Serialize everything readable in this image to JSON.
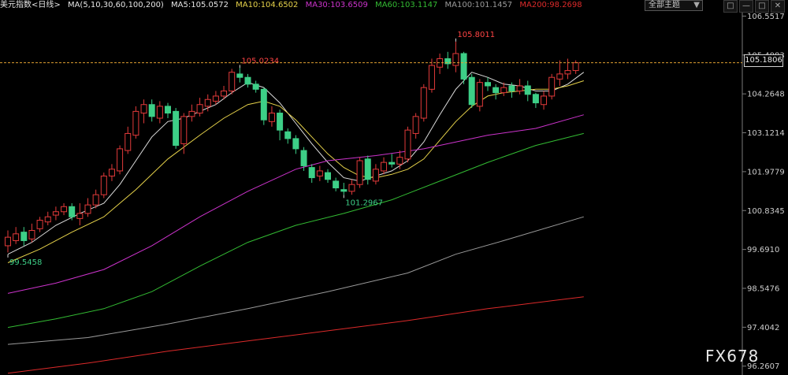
{
  "header": {
    "symbol": "美元指数",
    "period": "<日线>",
    "ma_params": "MA(5,10,30,60,100,200)",
    "ma5": "MA5:105.0572",
    "ma10": "MA10:104.6502",
    "ma30": "MA30:103.6509",
    "ma60": "MA60:103.1147",
    "ma100": "MA100:101.1457",
    "ma200": "MA200:98.2698"
  },
  "selector": {
    "label": "全部主题",
    "arrow": "▼"
  },
  "window_buttons": [
    "□",
    "—",
    "□",
    "✕"
  ],
  "watermark": "FX678",
  "current_price_tag": "105.1806",
  "colors": {
    "background": "#000000",
    "up_candle": "#e23a3a",
    "down_candle": "#3dcf87",
    "ma5": "#dcdcdc",
    "ma10": "#e6d24a",
    "ma30": "#cc33cc",
    "ma60": "#33bb33",
    "ma100": "#9a9a9a",
    "ma200": "#dd2a2a",
    "axis_text": "#cccccc",
    "annotation_high": "#ff4444",
    "annotation_low": "#3dcf87",
    "price_line": "#e0a030"
  },
  "chart_data": {
    "type": "candlestick",
    "y_axis_labels": [
      "106.5517",
      "105.4083",
      "104.2648",
      "103.1214",
      "101.9779",
      "100.8345",
      "99.6910",
      "98.5476",
      "97.4042",
      "96.2607"
    ],
    "ylim": [
      96.0,
      106.7
    ],
    "current_price": 105.1806,
    "annotations": [
      {
        "text": "105.8011",
        "index": 56,
        "value": 105.8011,
        "kind": "high"
      },
      {
        "text": "105.0234",
        "index": 29,
        "value": 105.0234,
        "kind": "high"
      },
      {
        "text": "101.2967",
        "index": 42,
        "value": 101.2967,
        "kind": "low"
      },
      {
        "text": "99.5458",
        "index": 0,
        "value": 99.5458,
        "kind": "low"
      }
    ],
    "candles": [
      [
        99.8,
        100.05,
        100.25,
        99.6
      ],
      [
        99.95,
        100.15,
        100.35,
        99.85
      ],
      [
        100.2,
        99.95,
        100.35,
        99.8
      ],
      [
        100.0,
        100.25,
        100.45,
        99.9
      ],
      [
        100.3,
        100.55,
        100.65,
        100.2
      ],
      [
        100.5,
        100.65,
        100.8,
        100.4
      ],
      [
        100.7,
        100.8,
        100.95,
        100.55
      ],
      [
        100.8,
        100.95,
        101.05,
        100.7
      ],
      [
        100.95,
        100.65,
        101.05,
        100.55
      ],
      [
        100.6,
        100.75,
        101.05,
        100.4
      ],
      [
        100.75,
        101.0,
        101.2,
        100.65
      ],
      [
        101.0,
        101.3,
        101.45,
        100.9
      ],
      [
        101.3,
        101.85,
        101.95,
        101.2
      ],
      [
        101.85,
        102.05,
        102.2,
        101.7
      ],
      [
        102.0,
        102.65,
        102.75,
        101.9
      ],
      [
        102.6,
        103.1,
        103.3,
        102.5
      ],
      [
        103.05,
        103.75,
        103.9,
        102.95
      ],
      [
        103.7,
        103.95,
        104.1,
        103.4
      ],
      [
        103.95,
        103.6,
        104.1,
        103.45
      ],
      [
        103.55,
        103.9,
        104.05,
        103.4
      ],
      [
        103.9,
        103.7,
        104.0,
        103.55
      ],
      [
        103.75,
        102.75,
        103.85,
        102.65
      ],
      [
        102.8,
        103.6,
        103.7,
        102.5
      ],
      [
        103.6,
        103.75,
        103.95,
        103.45
      ],
      [
        103.7,
        103.95,
        104.15,
        103.6
      ],
      [
        103.9,
        104.1,
        104.25,
        103.75
      ],
      [
        104.05,
        104.2,
        104.35,
        103.95
      ],
      [
        104.2,
        104.35,
        104.5,
        104.1
      ],
      [
        104.35,
        104.9,
        105.0,
        104.25
      ],
      [
        104.85,
        104.75,
        105.02,
        104.6
      ],
      [
        104.75,
        104.55,
        104.85,
        104.45
      ],
      [
        104.55,
        104.4,
        104.65,
        104.3
      ],
      [
        104.4,
        103.5,
        104.45,
        103.35
      ],
      [
        103.45,
        103.7,
        103.9,
        103.3
      ],
      [
        103.7,
        103.2,
        103.8,
        102.9
      ],
      [
        103.15,
        102.95,
        103.25,
        102.8
      ],
      [
        102.95,
        102.65,
        103.05,
        102.5
      ],
      [
        102.6,
        102.15,
        102.7,
        102.0
      ],
      [
        102.1,
        101.8,
        102.2,
        101.65
      ],
      [
        101.85,
        102.0,
        102.15,
        101.7
      ],
      [
        101.95,
        101.75,
        102.05,
        101.65
      ],
      [
        101.7,
        101.5,
        101.8,
        101.4
      ],
      [
        101.45,
        101.4,
        101.65,
        101.3
      ],
      [
        101.4,
        101.6,
        101.75,
        101.3
      ],
      [
        101.6,
        102.3,
        102.4,
        101.5
      ],
      [
        102.35,
        101.75,
        102.45,
        101.6
      ],
      [
        101.7,
        102.05,
        102.2,
        101.6
      ],
      [
        102.0,
        102.25,
        102.4,
        101.9
      ],
      [
        102.25,
        102.2,
        102.5,
        102.1
      ],
      [
        102.2,
        102.4,
        102.6,
        102.05
      ],
      [
        102.35,
        103.2,
        103.3,
        102.25
      ],
      [
        103.1,
        103.6,
        103.7,
        102.95
      ],
      [
        103.55,
        104.45,
        104.55,
        103.45
      ],
      [
        104.4,
        105.1,
        105.3,
        104.3
      ],
      [
        105.05,
        105.3,
        105.45,
        104.85
      ],
      [
        105.3,
        105.15,
        105.5,
        105.0
      ],
      [
        105.1,
        105.45,
        105.8011,
        104.9
      ],
      [
        105.45,
        104.7,
        105.5,
        104.55
      ],
      [
        104.75,
        103.95,
        104.85,
        103.85
      ],
      [
        103.9,
        104.6,
        104.7,
        103.75
      ],
      [
        104.6,
        104.5,
        104.75,
        104.35
      ],
      [
        104.45,
        104.3,
        104.55,
        104.1
      ],
      [
        104.3,
        104.45,
        104.6,
        104.2
      ],
      [
        104.5,
        104.35,
        104.6,
        104.15
      ],
      [
        104.35,
        104.5,
        104.7,
        104.25
      ],
      [
        104.5,
        104.25,
        104.65,
        104.05
      ],
      [
        104.25,
        104.0,
        104.3,
        103.85
      ],
      [
        103.95,
        104.2,
        104.35,
        103.8
      ],
      [
        104.2,
        104.75,
        104.85,
        104.1
      ],
      [
        104.7,
        104.85,
        105.25,
        104.5
      ],
      [
        104.85,
        104.95,
        105.3,
        104.7
      ],
      [
        104.95,
        105.18,
        105.25,
        104.85
      ]
    ],
    "ma_series": [
      {
        "name": "MA5",
        "color_key": "ma5",
        "points": [
          [
            0,
            99.55
          ],
          [
            3,
            99.9
          ],
          [
            6,
            100.4
          ],
          [
            9,
            100.75
          ],
          [
            12,
            101.05
          ],
          [
            14,
            101.6
          ],
          [
            16,
            102.3
          ],
          [
            18,
            103.0
          ],
          [
            20,
            103.45
          ],
          [
            22,
            103.55
          ],
          [
            24,
            103.75
          ],
          [
            26,
            103.95
          ],
          [
            28,
            104.3
          ],
          [
            30,
            104.6
          ],
          [
            32,
            104.45
          ],
          [
            34,
            104.0
          ],
          [
            36,
            103.4
          ],
          [
            38,
            102.8
          ],
          [
            40,
            102.25
          ],
          [
            42,
            101.8
          ],
          [
            44,
            101.7
          ],
          [
            46,
            101.85
          ],
          [
            48,
            102.0
          ],
          [
            50,
            102.3
          ],
          [
            52,
            102.85
          ],
          [
            54,
            103.65
          ],
          [
            56,
            104.4
          ],
          [
            58,
            104.9
          ],
          [
            60,
            104.75
          ],
          [
            62,
            104.55
          ],
          [
            64,
            104.5
          ],
          [
            66,
            104.35
          ],
          [
            68,
            104.35
          ],
          [
            70,
            104.55
          ],
          [
            72,
            104.9
          ]
        ]
      },
      {
        "name": "MA10",
        "color_key": "ma10",
        "points": [
          [
            0,
            99.3
          ],
          [
            4,
            99.7
          ],
          [
            8,
            100.2
          ],
          [
            12,
            100.65
          ],
          [
            16,
            101.45
          ],
          [
            20,
            102.35
          ],
          [
            24,
            103.05
          ],
          [
            27,
            103.55
          ],
          [
            30,
            103.95
          ],
          [
            32,
            104.05
          ],
          [
            34,
            103.9
          ],
          [
            36,
            103.5
          ],
          [
            38,
            103.0
          ],
          [
            40,
            102.5
          ],
          [
            42,
            102.1
          ],
          [
            44,
            101.85
          ],
          [
            46,
            101.8
          ],
          [
            48,
            101.9
          ],
          [
            50,
            102.05
          ],
          [
            52,
            102.35
          ],
          [
            54,
            102.9
          ],
          [
            56,
            103.45
          ],
          [
            58,
            103.9
          ],
          [
            60,
            104.2
          ],
          [
            62,
            104.3
          ],
          [
            64,
            104.35
          ],
          [
            66,
            104.4
          ],
          [
            68,
            104.4
          ],
          [
            70,
            104.5
          ],
          [
            72,
            104.65
          ]
        ]
      },
      {
        "name": "MA30",
        "color_key": "ma30",
        "points": [
          [
            0,
            98.4
          ],
          [
            6,
            98.7
          ],
          [
            12,
            99.1
          ],
          [
            18,
            99.8
          ],
          [
            24,
            100.65
          ],
          [
            30,
            101.4
          ],
          [
            36,
            102.05
          ],
          [
            40,
            102.3
          ],
          [
            46,
            102.45
          ],
          [
            52,
            102.65
          ],
          [
            56,
            102.85
          ],
          [
            60,
            103.05
          ],
          [
            66,
            103.25
          ],
          [
            72,
            103.65
          ]
        ]
      },
      {
        "name": "MA60",
        "color_key": "ma60",
        "points": [
          [
            0,
            97.4
          ],
          [
            6,
            97.65
          ],
          [
            12,
            97.95
          ],
          [
            18,
            98.45
          ],
          [
            24,
            99.2
          ],
          [
            30,
            99.9
          ],
          [
            36,
            100.4
          ],
          [
            42,
            100.75
          ],
          [
            48,
            101.15
          ],
          [
            54,
            101.7
          ],
          [
            60,
            102.25
          ],
          [
            66,
            102.75
          ],
          [
            72,
            103.1
          ]
        ]
      },
      {
        "name": "MA100",
        "color_key": "ma100",
        "points": [
          [
            0,
            96.9
          ],
          [
            10,
            97.1
          ],
          [
            20,
            97.5
          ],
          [
            30,
            97.95
          ],
          [
            40,
            98.45
          ],
          [
            50,
            99.0
          ],
          [
            56,
            99.55
          ],
          [
            62,
            99.95
          ],
          [
            72,
            100.65
          ]
        ]
      },
      {
        "name": "MA200",
        "color_key": "ma200",
        "points": [
          [
            0,
            96.05
          ],
          [
            10,
            96.35
          ],
          [
            20,
            96.7
          ],
          [
            30,
            97.0
          ],
          [
            40,
            97.3
          ],
          [
            50,
            97.6
          ],
          [
            60,
            97.95
          ],
          [
            72,
            98.3
          ]
        ]
      }
    ]
  }
}
